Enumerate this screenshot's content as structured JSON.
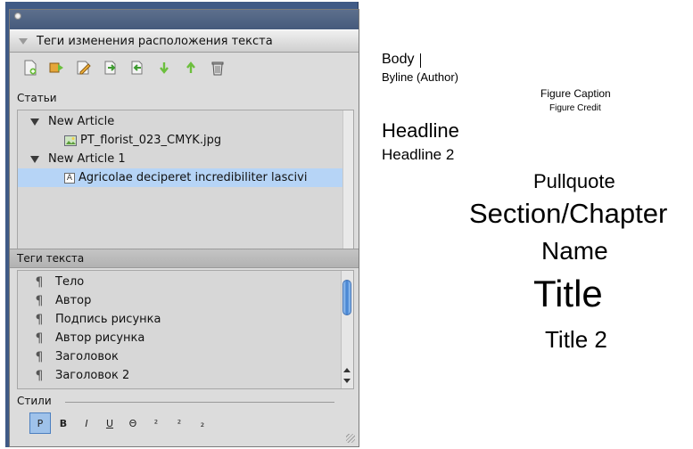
{
  "panel": {
    "section_title": "Теги изменения расположения текста",
    "toolbar_icons": [
      "new-article-icon",
      "add-to-article-icon",
      "edit-icon",
      "import-icon",
      "export-icon",
      "move-down-icon",
      "move-up-icon",
      "trash-icon"
    ],
    "articles_label": "Статьи",
    "articles": [
      {
        "label": "New Article",
        "child": "PT_florist_023_CMYK.jpg"
      },
      {
        "label": "New Article 1",
        "child": "Agricolae deciperet incredibiliter lascivi"
      }
    ],
    "text_tags_label": "Теги текста",
    "text_tags": [
      "Тело",
      "Автор",
      "Подпись рисунка",
      "Автор рисунка",
      "Заголовок",
      "Заголовок 2"
    ],
    "styles_label": "Стили",
    "style_buttons": [
      "P",
      "B",
      "I",
      "U",
      "Θ",
      "²",
      "²",
      "₂"
    ]
  },
  "preview": {
    "body": "Body",
    "byline": "Byline (Author)",
    "figure_caption": "Figure Caption",
    "figure_credit": "Figure Credit",
    "headline": "Headline",
    "headline2": "Headline 2",
    "pullquote": "Pullquote",
    "section": "Section/Chapter",
    "name": "Name",
    "title": "Title",
    "title2": "Title 2"
  }
}
